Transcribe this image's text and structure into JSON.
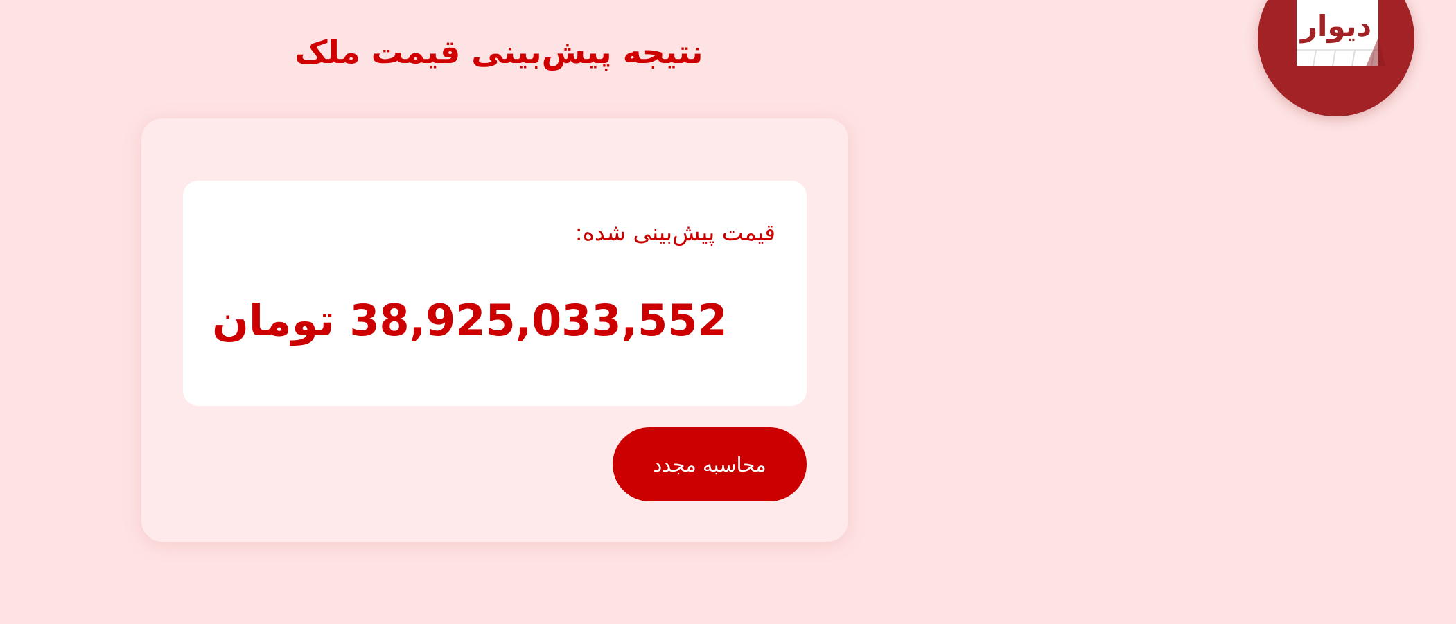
{
  "header": {
    "title": "نتیجه پیش‌بینی قیمت ملک"
  },
  "logo": {
    "text": "دیوار",
    "icon": "divar-logo-icon",
    "color": "#a32226"
  },
  "result": {
    "label": "قیمت پیش‌بینی شده:",
    "value": "38,925,033,552 تومان"
  },
  "actions": {
    "recalculate_label": "محاسبه مجدد"
  },
  "colors": {
    "background": "#fee3e4",
    "card": "#ffeaeb",
    "accent": "#cc0000"
  }
}
